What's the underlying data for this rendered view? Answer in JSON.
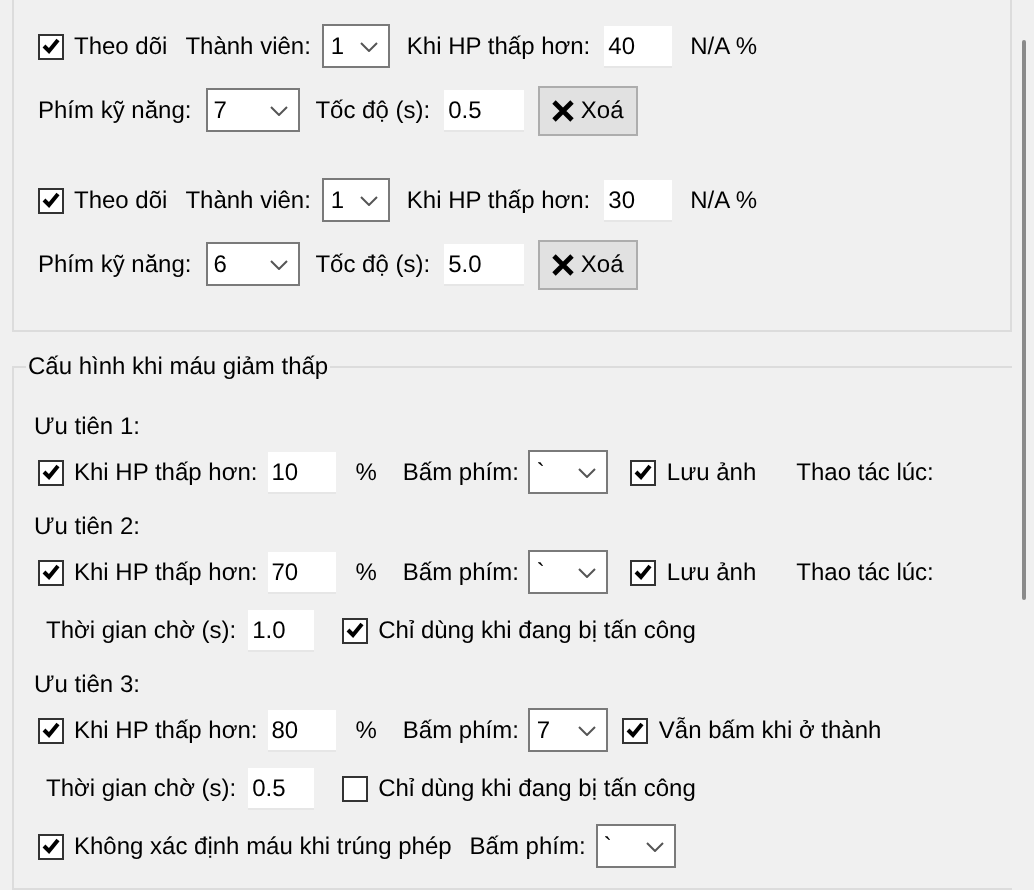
{
  "monitors": [
    {
      "follow": {
        "label": "Theo dõi",
        "checked": true
      },
      "member_label": "Thành viên:",
      "member": "1",
      "hp_label": "Khi HP thấp hơn:",
      "hp": "40",
      "hp_unit": "N/A %",
      "skill_label": "Phím kỹ năng:",
      "skill": "7",
      "speed_label": "Tốc độ (s):",
      "speed": "0.5",
      "delete_button": "Xoá"
    },
    {
      "follow": {
        "label": "Theo dõi",
        "checked": true
      },
      "member_label": "Thành viên:",
      "member": "1",
      "hp_label": "Khi HP thấp hơn:",
      "hp": "30",
      "hp_unit": "N/A %",
      "skill_label": "Phím kỹ năng:",
      "skill": "6",
      "speed_label": "Tốc độ (s):",
      "speed": "5.0",
      "delete_button": "Xoá"
    }
  ],
  "low_hp": {
    "title": "Cấu hình khi máu giảm thấp",
    "priorities": [
      {
        "heading": "Ưu tiên 1:",
        "hp_check": {
          "label": "Khi HP thấp hơn:",
          "checked": true
        },
        "hp": "10",
        "unit": "%",
        "key_label": "Bấm phím:",
        "key": "`",
        "option": {
          "label": "Lưu ảnh",
          "checked": true
        },
        "action_label": "Thao tác lúc:"
      },
      {
        "heading": "Ưu tiên 2:",
        "hp_check": {
          "label": "Khi HP thấp hơn:",
          "checked": true
        },
        "hp": "70",
        "unit": "%",
        "key_label": "Bấm phím:",
        "key": "`",
        "option": {
          "label": "Lưu ảnh",
          "checked": true
        },
        "action_label": "Thao tác lúc:",
        "wait": {
          "label": "Thời gian chờ (s):",
          "value": "1.0",
          "attack": {
            "label": "Chỉ dùng khi đang bị tấn công",
            "checked": true
          }
        }
      },
      {
        "heading": "Ưu tiên 3:",
        "hp_check": {
          "label": "Khi HP thấp hơn:",
          "checked": true
        },
        "hp": "80",
        "unit": "%",
        "key_label": "Bấm phím:",
        "key": "7",
        "option": {
          "label": "Vẫn bấm khi ở thành",
          "checked": true
        },
        "wait": {
          "label": "Thời gian chờ (s):",
          "value": "0.5",
          "attack": {
            "label": "Chỉ dùng khi đang bị tấn công",
            "checked": false
          }
        }
      }
    ],
    "magic": {
      "label": "Không xác định máu khi trúng phép",
      "checked": true,
      "key_label": "Bấm phím:",
      "key": "`"
    }
  }
}
